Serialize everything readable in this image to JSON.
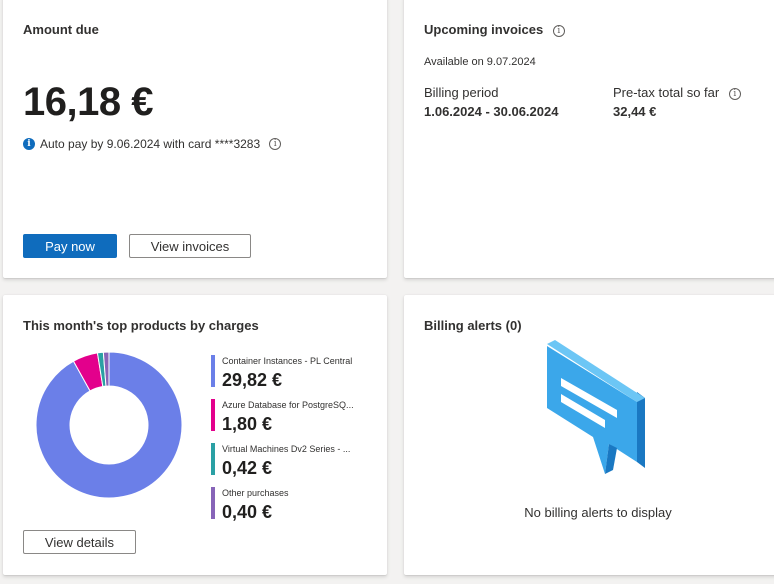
{
  "amount_due": {
    "title": "Amount due",
    "value": "16,18 €",
    "autopay_text": "Auto pay by 9.06.2024 with card ****3283",
    "pay_now_label": "Pay now",
    "view_invoices_label": "View invoices"
  },
  "upcoming_invoices": {
    "title": "Upcoming invoices",
    "available_text": "Available on 9.07.2024",
    "billing_period_label": "Billing period",
    "billing_period_value": "1.06.2024 - 30.06.2024",
    "pretax_label": "Pre-tax total so far",
    "pretax_value": "32,44 €"
  },
  "top_products": {
    "title": "This month's top products by charges",
    "view_details_label": "View details",
    "items": [
      {
        "name": "Container Instances - PL Central",
        "value": "29,82 €",
        "color": "#6b7fe8"
      },
      {
        "name": "Azure Database for PostgreSQ...",
        "value": "1,80 €",
        "color": "#e3008c"
      },
      {
        "name": "Virtual Machines Dv2 Series - ...",
        "value": "0,42 €",
        "color": "#2aa0a4"
      },
      {
        "name": "Other purchases",
        "value": "0,40 €",
        "color": "#8764b8"
      }
    ]
  },
  "billing_alerts": {
    "title": "Billing alerts (0)",
    "empty_text": "No billing alerts to display"
  },
  "icons": {
    "info": "info-icon",
    "info_filled": "info-filled-icon",
    "chat": "chat-bubble-illustration"
  },
  "chart_data": {
    "type": "pie",
    "donut": true,
    "categories": [
      "Container Instances - PL Central",
      "Azure Database for PostgreSQ...",
      "Virtual Machines Dv2 Series - ...",
      "Other purchases"
    ],
    "values": [
      29.82,
      1.8,
      0.42,
      0.4
    ],
    "colors": [
      "#6b7fe8",
      "#e3008c",
      "#2aa0a4",
      "#8764b8"
    ]
  }
}
